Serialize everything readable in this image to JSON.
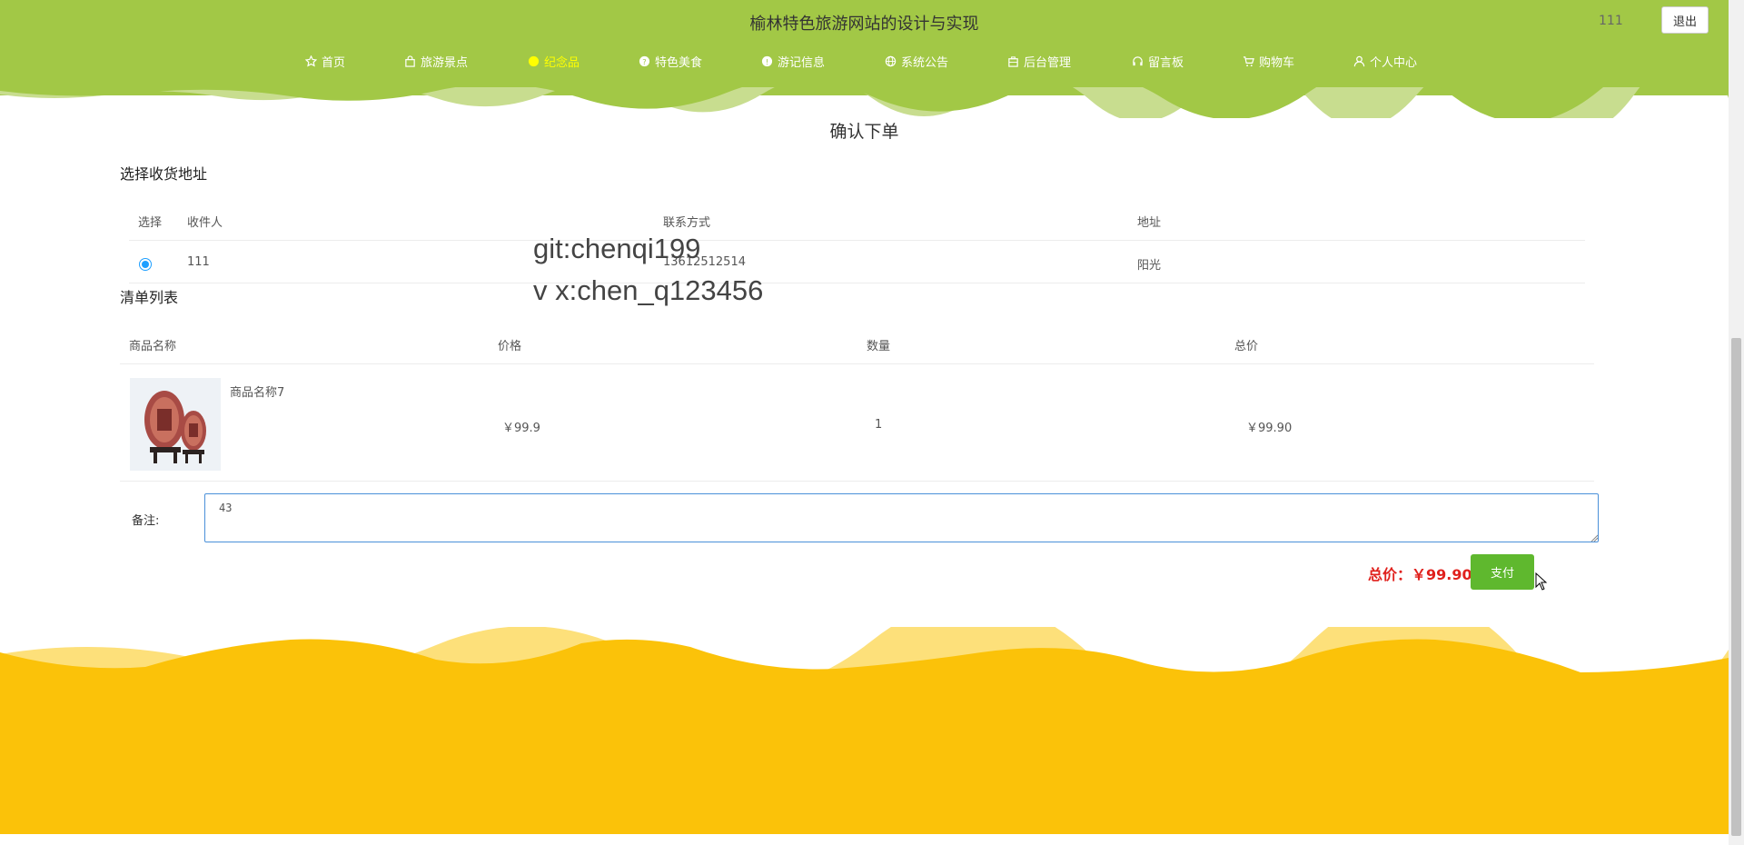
{
  "header": {
    "site_title": "榆林特色旅游网站的设计与实现",
    "username": "111",
    "logout_label": "退出",
    "nav": [
      {
        "label": "首页",
        "icon": "star-icon"
      },
      {
        "label": "旅游景点",
        "icon": "bag-icon"
      },
      {
        "label": "纪念品",
        "icon": "circle-icon",
        "active": true
      },
      {
        "label": "特色美食",
        "icon": "help-circle-icon"
      },
      {
        "label": "游记信息",
        "icon": "info-circle-icon"
      },
      {
        "label": "系统公告",
        "icon": "globe-icon"
      },
      {
        "label": "后台管理",
        "icon": "briefcase-icon"
      },
      {
        "label": "留言板",
        "icon": "headset-icon"
      },
      {
        "label": "购物车",
        "icon": "cart-icon"
      },
      {
        "label": "个人中心",
        "icon": "user-icon"
      }
    ],
    "colors": {
      "header_bg": "#a2c846",
      "nav_text": "#ffffff",
      "nav_active": "#ffff00"
    }
  },
  "page_title": "确认下单",
  "address_section": {
    "label": "选择收货地址",
    "columns": [
      "选择",
      "收件人",
      "联系方式",
      "地址"
    ],
    "rows": [
      {
        "selected": true,
        "recipient": "111",
        "phone": "13612512514",
        "address": "阳光"
      }
    ]
  },
  "watermark": {
    "line1": "git:chenqi199",
    "line2": "v x:chen_q123456"
  },
  "order_section": {
    "label": "清单列表",
    "columns": [
      "商品名称",
      "价格",
      "数量",
      "总价"
    ],
    "items": [
      {
        "name": "商品名称7",
        "price": "￥99.9",
        "quantity": "1",
        "total": "￥99.90"
      }
    ]
  },
  "remark": {
    "label": "备注:",
    "value": "43"
  },
  "summary": {
    "total_text": "总价：￥99.90",
    "pay_label": "支付",
    "colors": {
      "total": "#e0211d",
      "pay_button": "#5fb82e"
    }
  },
  "footer": {
    "colors": {
      "wave_main": "#fbc209",
      "wave_light": "#fde07a"
    }
  }
}
